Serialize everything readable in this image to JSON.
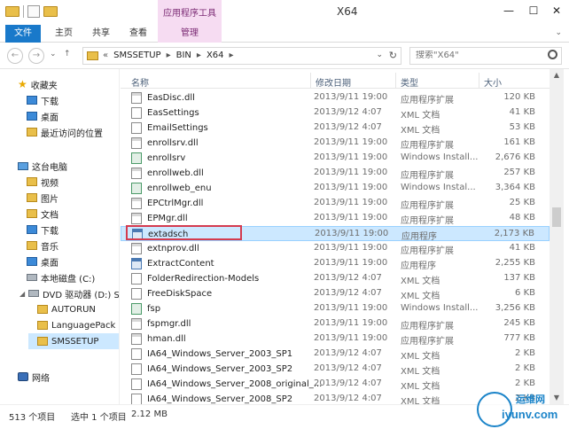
{
  "window": {
    "title": "X64",
    "context_tab": "应用程序工具",
    "minimize": "—",
    "maximize": "☐",
    "close": "✕"
  },
  "ribbon": {
    "tabs": [
      "文件",
      "主页",
      "共享",
      "查看",
      "管理"
    ],
    "expand": "⌄"
  },
  "nav": {
    "back": "←",
    "forward": "→",
    "recent": "⌄",
    "up": "↑"
  },
  "address": {
    "prefix": "«",
    "crumbs": [
      "SMSSETUP",
      "BIN",
      "X64"
    ],
    "dropdown": "⌄",
    "refresh": "↻"
  },
  "search": {
    "placeholder": "搜索\"X64\""
  },
  "sidebar": {
    "favorites": "收藏夹",
    "downloads": "下载",
    "desktop": "桌面",
    "recent": "最近访问的位置",
    "this_pc": "这台电脑",
    "videos": "视频",
    "pictures": "图片",
    "documents": "文档",
    "downloads2": "下载",
    "music": "音乐",
    "desktop2": "桌面",
    "local_disk": "本地磁盘 (C:)",
    "dvd": "DVD 驱动器 (D:) SC",
    "autorun": "AUTORUN",
    "languagepack": "LanguagePack",
    "smssetup": "SMSSETUP",
    "network": "网络"
  },
  "columns": {
    "name": "名称",
    "date": "修改日期",
    "type": "类型",
    "size": "大小"
  },
  "files": [
    {
      "name": "EasDisc.dll",
      "date": "2013/9/11 19:00",
      "type": "应用程序扩展",
      "size": "120 KB",
      "icon": "dll"
    },
    {
      "name": "EasSettings",
      "date": "2013/9/12 4:07",
      "type": "XML 文档",
      "size": "41 KB",
      "icon": "xml"
    },
    {
      "name": "EmailSettings",
      "date": "2013/9/12 4:07",
      "type": "XML 文档",
      "size": "53 KB",
      "icon": "xml"
    },
    {
      "name": "enrollsrv.dll",
      "date": "2013/9/11 19:00",
      "type": "应用程序扩展",
      "size": "161 KB",
      "icon": "dll"
    },
    {
      "name": "enrollsrv",
      "date": "2013/9/11 19:00",
      "type": "Windows Install...",
      "size": "2,676 KB",
      "icon": "msi"
    },
    {
      "name": "enrollweb.dll",
      "date": "2013/9/11 19:00",
      "type": "应用程序扩展",
      "size": "257 KB",
      "icon": "dll"
    },
    {
      "name": "enrollweb_enu",
      "date": "2013/9/11 19:00",
      "type": "Windows Instal...",
      "size": "3,364 KB",
      "icon": "msi"
    },
    {
      "name": "EPCtrlMgr.dll",
      "date": "2013/9/11 19:00",
      "type": "应用程序扩展",
      "size": "25 KB",
      "icon": "dll"
    },
    {
      "name": "EPMgr.dll",
      "date": "2013/9/11 19:00",
      "type": "应用程序扩展",
      "size": "48 KB",
      "icon": "dll"
    },
    {
      "name": "extadsch",
      "date": "2013/9/11 19:00",
      "type": "应用程序",
      "size": "2,173 KB",
      "icon": "exe"
    },
    {
      "name": "extnprov.dll",
      "date": "2013/9/11 19:00",
      "type": "应用程序扩展",
      "size": "41 KB",
      "icon": "dll"
    },
    {
      "name": "ExtractContent",
      "date": "2013/9/11 19:00",
      "type": "应用程序",
      "size": "2,255 KB",
      "icon": "exe"
    },
    {
      "name": "FolderRedirection-Models",
      "date": "2013/9/12 4:07",
      "type": "XML 文档",
      "size": "137 KB",
      "icon": "xml"
    },
    {
      "name": "FreeDiskSpace",
      "date": "2013/9/12 4:07",
      "type": "XML 文档",
      "size": "6 KB",
      "icon": "xml"
    },
    {
      "name": "fsp",
      "date": "2013/9/11 19:00",
      "type": "Windows Install...",
      "size": "3,256 KB",
      "icon": "msi"
    },
    {
      "name": "fspmgr.dll",
      "date": "2013/9/11 19:00",
      "type": "应用程序扩展",
      "size": "245 KB",
      "icon": "dll"
    },
    {
      "name": "hman.dll",
      "date": "2013/9/11 19:00",
      "type": "应用程序扩展",
      "size": "777 KB",
      "icon": "dll"
    },
    {
      "name": "IA64_Windows_Server_2003_SP1",
      "date": "2013/9/12 4:07",
      "type": "XML 文档",
      "size": "2 KB",
      "icon": "xml"
    },
    {
      "name": "IA64_Windows_Server_2003_SP2",
      "date": "2013/9/12 4:07",
      "type": "XML 文档",
      "size": "2 KB",
      "icon": "xml"
    },
    {
      "name": "IA64_Windows_Server_2008_original_...",
      "date": "2013/9/12 4:07",
      "type": "XML 文档",
      "size": "2 KB",
      "icon": "xml"
    },
    {
      "name": "IA64_Windows_Server_2008_SP2",
      "date": "2013/9/12 4:07",
      "type": "XML 文档",
      "size": "2 KB",
      "icon": "xml"
    }
  ],
  "selected_index": 9,
  "status": {
    "count": "513 个项目",
    "selected": "选中 1 个项目",
    "size": "2.12 MB"
  },
  "watermark": {
    "cn": "运维网",
    "en": "iyunv.com"
  },
  "colors": {
    "accent": "#1979ca",
    "context": "#f6dcf2",
    "selection": "#cce8ff",
    "highlight_box": "#d43b4f"
  }
}
